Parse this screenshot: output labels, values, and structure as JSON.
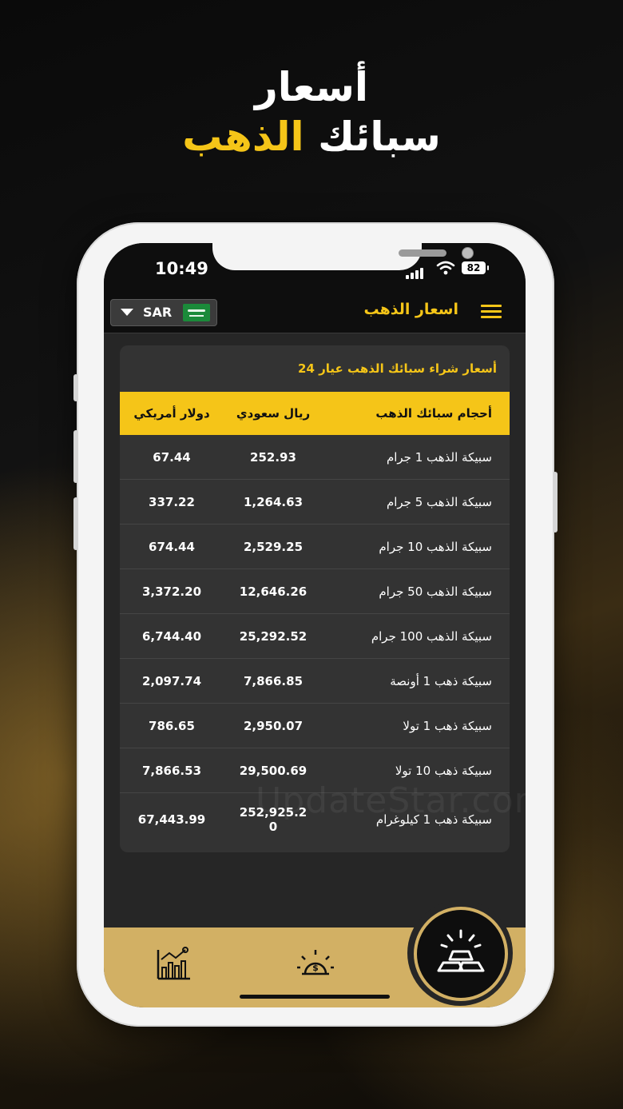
{
  "promo": {
    "line1": "أسعار",
    "line2_white": "سبائك",
    "line2_gold": "الذهب"
  },
  "status_bar": {
    "time": "10:49",
    "battery": "82"
  },
  "header": {
    "title": "اسعار الذهب",
    "currency": "SAR",
    "menu_icon": "hamburger-icon",
    "flag_icon": "saudi-flag-icon"
  },
  "card": {
    "title": "أسعار شراء سبائك الذهب عيار 24",
    "columns": [
      "أحجام سبائك الذهب",
      "ريال سعودي",
      "دولار أمريكي"
    ],
    "rows": [
      {
        "name": "سبيكة الذهب 1 جرام",
        "sar": "252.93",
        "usd": "67.44"
      },
      {
        "name": "سبيكة الذهب 5 جرام",
        "sar": "1,264.63",
        "usd": "337.22"
      },
      {
        "name": "سبيكة الذهب 10 جرام",
        "sar": "2,529.25",
        "usd": "674.44"
      },
      {
        "name": "سبيكة الذهب 50 جرام",
        "sar": "12,646.26",
        "usd": "3,372.20"
      },
      {
        "name": "سبيكة الذهب 100 جرام",
        "sar": "25,292.52",
        "usd": "6,744.40"
      },
      {
        "name": "سبيكة ذهب 1 أونصة",
        "sar": "7,866.85",
        "usd": "2,097.74"
      },
      {
        "name": "سبيكة ذهب 1 تولا",
        "sar": "2,950.07",
        "usd": "786.65"
      },
      {
        "name": "سبيكة ذهب 10 تولا",
        "sar": "29,500.69",
        "usd": "7,866.53"
      },
      {
        "name": "سبيكة ذهب 1 كيلوغرام",
        "sar": "252,925.20",
        "usd": "67,443.99"
      }
    ]
  },
  "watermark": "UpdateStar.com",
  "bottom_nav": {
    "items": [
      "chart-icon",
      "gold-coin-sun-icon",
      "gold-bars-icon"
    ],
    "active": "gold-bars-icon"
  },
  "colors": {
    "gold": "#f5c518",
    "nav_gold": "#d2b064",
    "screen_bg": "#262626",
    "card_bg": "#333333"
  }
}
